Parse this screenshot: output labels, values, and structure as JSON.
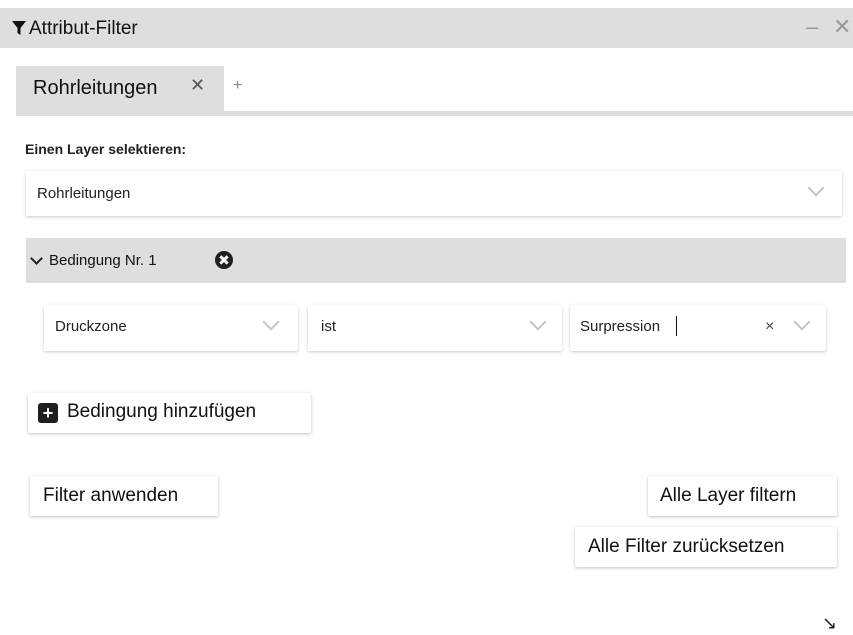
{
  "window": {
    "title": "Attribut-Filter",
    "minimize_glyph": "–",
    "close_glyph": "✕",
    "icon": "filter-funnel-icon"
  },
  "tabs": [
    {
      "label": "Rohrleitungen",
      "close_glyph": "✕"
    }
  ],
  "add_tab_glyph": "+",
  "layer": {
    "label": "Einen Layer selektieren:",
    "selected": "Rohrleitungen"
  },
  "condition": {
    "title": "Bedingung Nr. 1",
    "remove_glyph": "✖",
    "attribute": "Druckzone",
    "operator": "ist",
    "value": "Surpression",
    "clear_glyph": "×"
  },
  "buttons": {
    "add_condition": "Bedingung hinzufügen",
    "add_icon_glyph": "+",
    "apply": "Filter anwenden",
    "filter_all": "Alle Layer filtern",
    "reset_all": "Alle Filter zurücksetzen"
  },
  "resize_glyph": "↘",
  "colors": {
    "header_bg": "#dedede",
    "accent_dark": "#1f1f1f"
  }
}
